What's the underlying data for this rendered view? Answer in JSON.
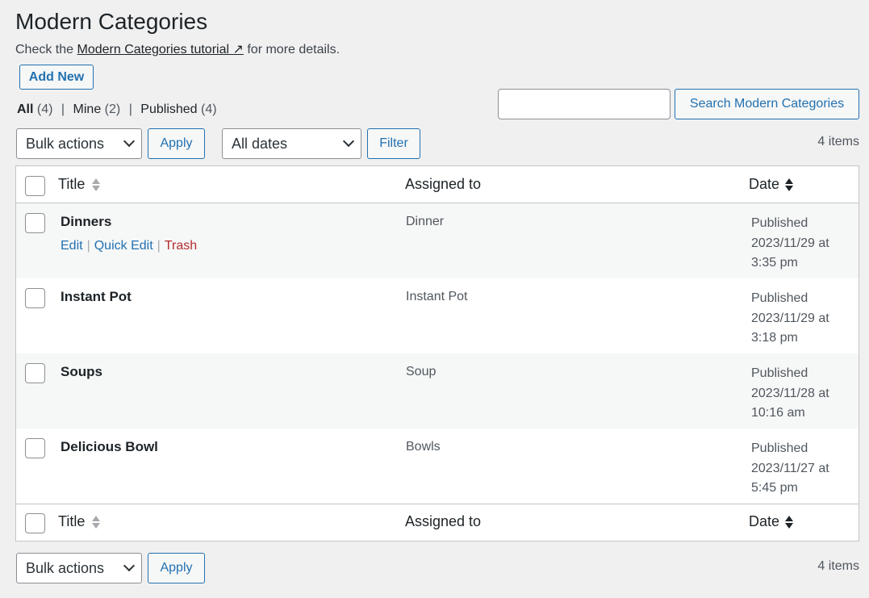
{
  "page": {
    "title": "Modern Categories",
    "intro_prefix": "Check the",
    "intro_link": "Modern Categories tutorial ↗",
    "intro_suffix": "for more details.",
    "add_new": "Add New"
  },
  "views": {
    "all_label": "All",
    "all_count": "(4)",
    "mine_label": "Mine",
    "mine_count": "(2)",
    "published_label": "Published",
    "published_count": "(4)",
    "separator": "|"
  },
  "search": {
    "value": "",
    "button_label": "Search Modern Categories"
  },
  "tablenav_top": {
    "bulk_actions": "Bulk actions",
    "apply": "Apply",
    "dates": "All dates",
    "filter": "Filter",
    "items": "4 items"
  },
  "tablenav_bottom": {
    "bulk_actions": "Bulk actions",
    "apply": "Apply",
    "items": "4 items"
  },
  "columns": {
    "title": "Title",
    "assigned": "Assigned to",
    "date": "Date"
  },
  "row_actions": {
    "edit": "Edit",
    "quick_edit": "Quick Edit",
    "trash": "Trash",
    "separator": "|"
  },
  "rows": [
    {
      "title": "Dinners",
      "assigned": "Dinner",
      "status": "Published",
      "date": "2023/11/29 at",
      "time": "3:35 pm"
    },
    {
      "title": "Instant Pot",
      "assigned": "Instant Pot",
      "status": "Published",
      "date": "2023/11/29 at",
      "time": "3:18 pm"
    },
    {
      "title": "Soups",
      "assigned": "Soup",
      "status": "Published",
      "date": "2023/11/28 at",
      "time": "10:16 am"
    },
    {
      "title": "Delicious Bowl",
      "assigned": "Bowls",
      "status": "Published",
      "date": "2023/11/27 at",
      "time": "5:45 pm"
    }
  ],
  "colors": {
    "accent": "#2271b1",
    "trash": "#b32d2e",
    "background": "#f0f0f1"
  }
}
